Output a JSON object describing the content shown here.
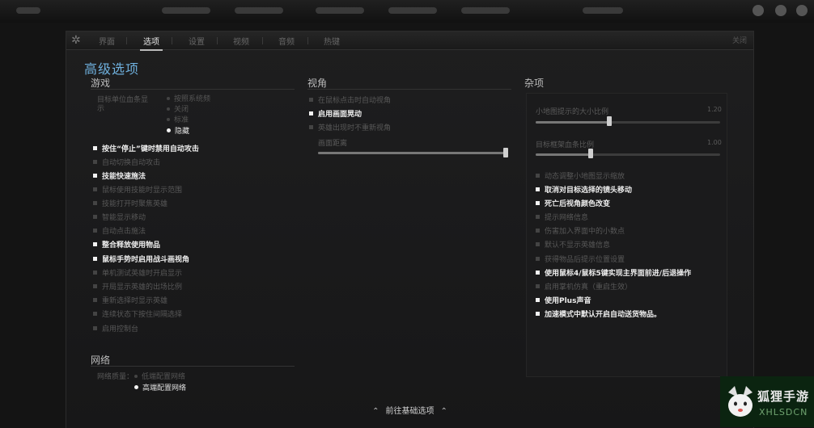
{
  "window": {
    "tabs": [
      {
        "label": "界面"
      },
      {
        "label": "选项"
      },
      {
        "label": "设置"
      },
      {
        "label": "视频"
      },
      {
        "label": "音频"
      },
      {
        "label": "热键"
      }
    ],
    "active_tab": 1,
    "close_label": "关闭"
  },
  "page_title": "高级选项",
  "game": {
    "title": "游戏",
    "radio_label": "目标单位血条显示",
    "radios": [
      {
        "label": "按照系统频",
        "selected": false
      },
      {
        "label": "关闭",
        "selected": false
      },
      {
        "label": "标准",
        "selected": false
      },
      {
        "label": "隐藏",
        "selected": true
      }
    ],
    "checkboxes": [
      {
        "label": "按住“停止”键时禁用自动攻击",
        "checked": true
      },
      {
        "label": "自动切换自动攻击",
        "checked": false
      },
      {
        "label": "技能快速施法",
        "checked": true
      },
      {
        "label": "鼠标使用技能时显示范围",
        "checked": false
      },
      {
        "label": "技能打开时聚焦英雄",
        "checked": false
      },
      {
        "label": "智能显示移动",
        "checked": false
      },
      {
        "label": "自动点击施法",
        "checked": false
      },
      {
        "label": "整合释放使用物品",
        "checked": true
      },
      {
        "label": "鼠标手势时启用战斗画视角",
        "checked": true
      },
      {
        "label": "单机测试英雄时开启显示",
        "checked": false
      },
      {
        "label": "开局显示英雄的出场比例",
        "checked": false
      },
      {
        "label": "重新选择时显示英雄",
        "checked": false
      },
      {
        "label": "连续状态下按住间隔选择",
        "checked": false
      },
      {
        "label": "启用控制台",
        "checked": false
      }
    ]
  },
  "network": {
    "title": "网络",
    "radio_label": "网络质量：",
    "radios": [
      {
        "label": "低端配置网络",
        "selected": false
      },
      {
        "label": "高端配置网络",
        "selected": true
      }
    ]
  },
  "camera": {
    "title": "视角",
    "checkboxes": [
      {
        "label": "在鼠标点击时自动视角",
        "checked": false
      },
      {
        "label": "启用画面晃动",
        "checked": true
      },
      {
        "label": "英雄出现时不重新视角",
        "checked": false
      }
    ],
    "slider": {
      "label": "画面距离",
      "value": 1.0
    }
  },
  "misc": {
    "title": "杂项",
    "sliders": [
      {
        "label": "小地图提示的大小比例",
        "display": "1.20",
        "value": 0.4
      },
      {
        "label": "目标框架血条比例",
        "display": "1.00",
        "value": 0.3
      }
    ],
    "checkboxes": [
      {
        "label": "动态调整小地图显示缩放",
        "checked": false
      },
      {
        "label": "取消对目标选择的镜头移动",
        "checked": true
      },
      {
        "label": "死亡后视角颜色改变",
        "checked": true
      },
      {
        "label": "提示网络信息",
        "checked": false
      },
      {
        "label": "伤害加入界面中的小数点",
        "checked": false
      },
      {
        "label": "默认不显示英雄信息",
        "checked": false
      },
      {
        "label": "获得物品后提示位置设置",
        "checked": false
      },
      {
        "label": "使用鼠标4/鼠标5键实现主界面前进/后退操作",
        "checked": true
      },
      {
        "label": "启用掌机仿真（重启生效）",
        "checked": false
      },
      {
        "label": "使用Plus声音",
        "checked": true
      },
      {
        "label": "加速模式中默认开启自动送货物品。",
        "checked": true
      }
    ]
  },
  "footer": {
    "label": "前往基础选项"
  },
  "watermark": {
    "line1": "狐狸手游",
    "line2": "XHLSDCN"
  }
}
